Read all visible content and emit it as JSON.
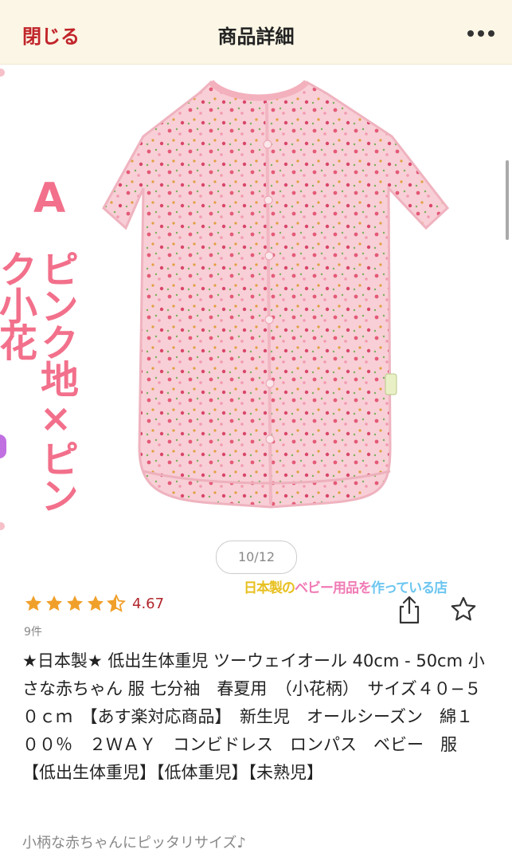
{
  "header": {
    "close_label": "閉じる",
    "title": "商品詳細",
    "more_icon": "more-horizontal-icon"
  },
  "gallery": {
    "variant_letter": "A",
    "variant_name": "ピンク地×ピンク小花",
    "shop_tag": {
      "part1": "日本製の",
      "part2": "ベビー用品を",
      "part3": "作っている店"
    },
    "pager": "10/12"
  },
  "product": {
    "rating_value": 4.67,
    "rating_text": "4.67",
    "review_count": "9件",
    "title": "★日本製★ 低出生体重児 ツーウェイオール 40cm - 50cm 小さな赤ちゃん 服 七分袖　春夏用　（小花柄）　サイズ４０−５０ｃｍ　【あす楽対応商品】　新生児　オールシーズン　綿１００％　２ＷＡＹ　コンビドレス　ロンパス　ベビー　服【低出生体重児】【低体重児】【未熟児】",
    "catchcopy": "小柄な赤ちゃんにピッタリサイズ♪",
    "share_icon": "share-icon",
    "favorite_icon": "star-outline-icon"
  },
  "colors": {
    "accent": "#c1242a",
    "star": "#f0a02a",
    "header_bg": "#fbf6e5",
    "variant_pink": "#f2708b"
  }
}
